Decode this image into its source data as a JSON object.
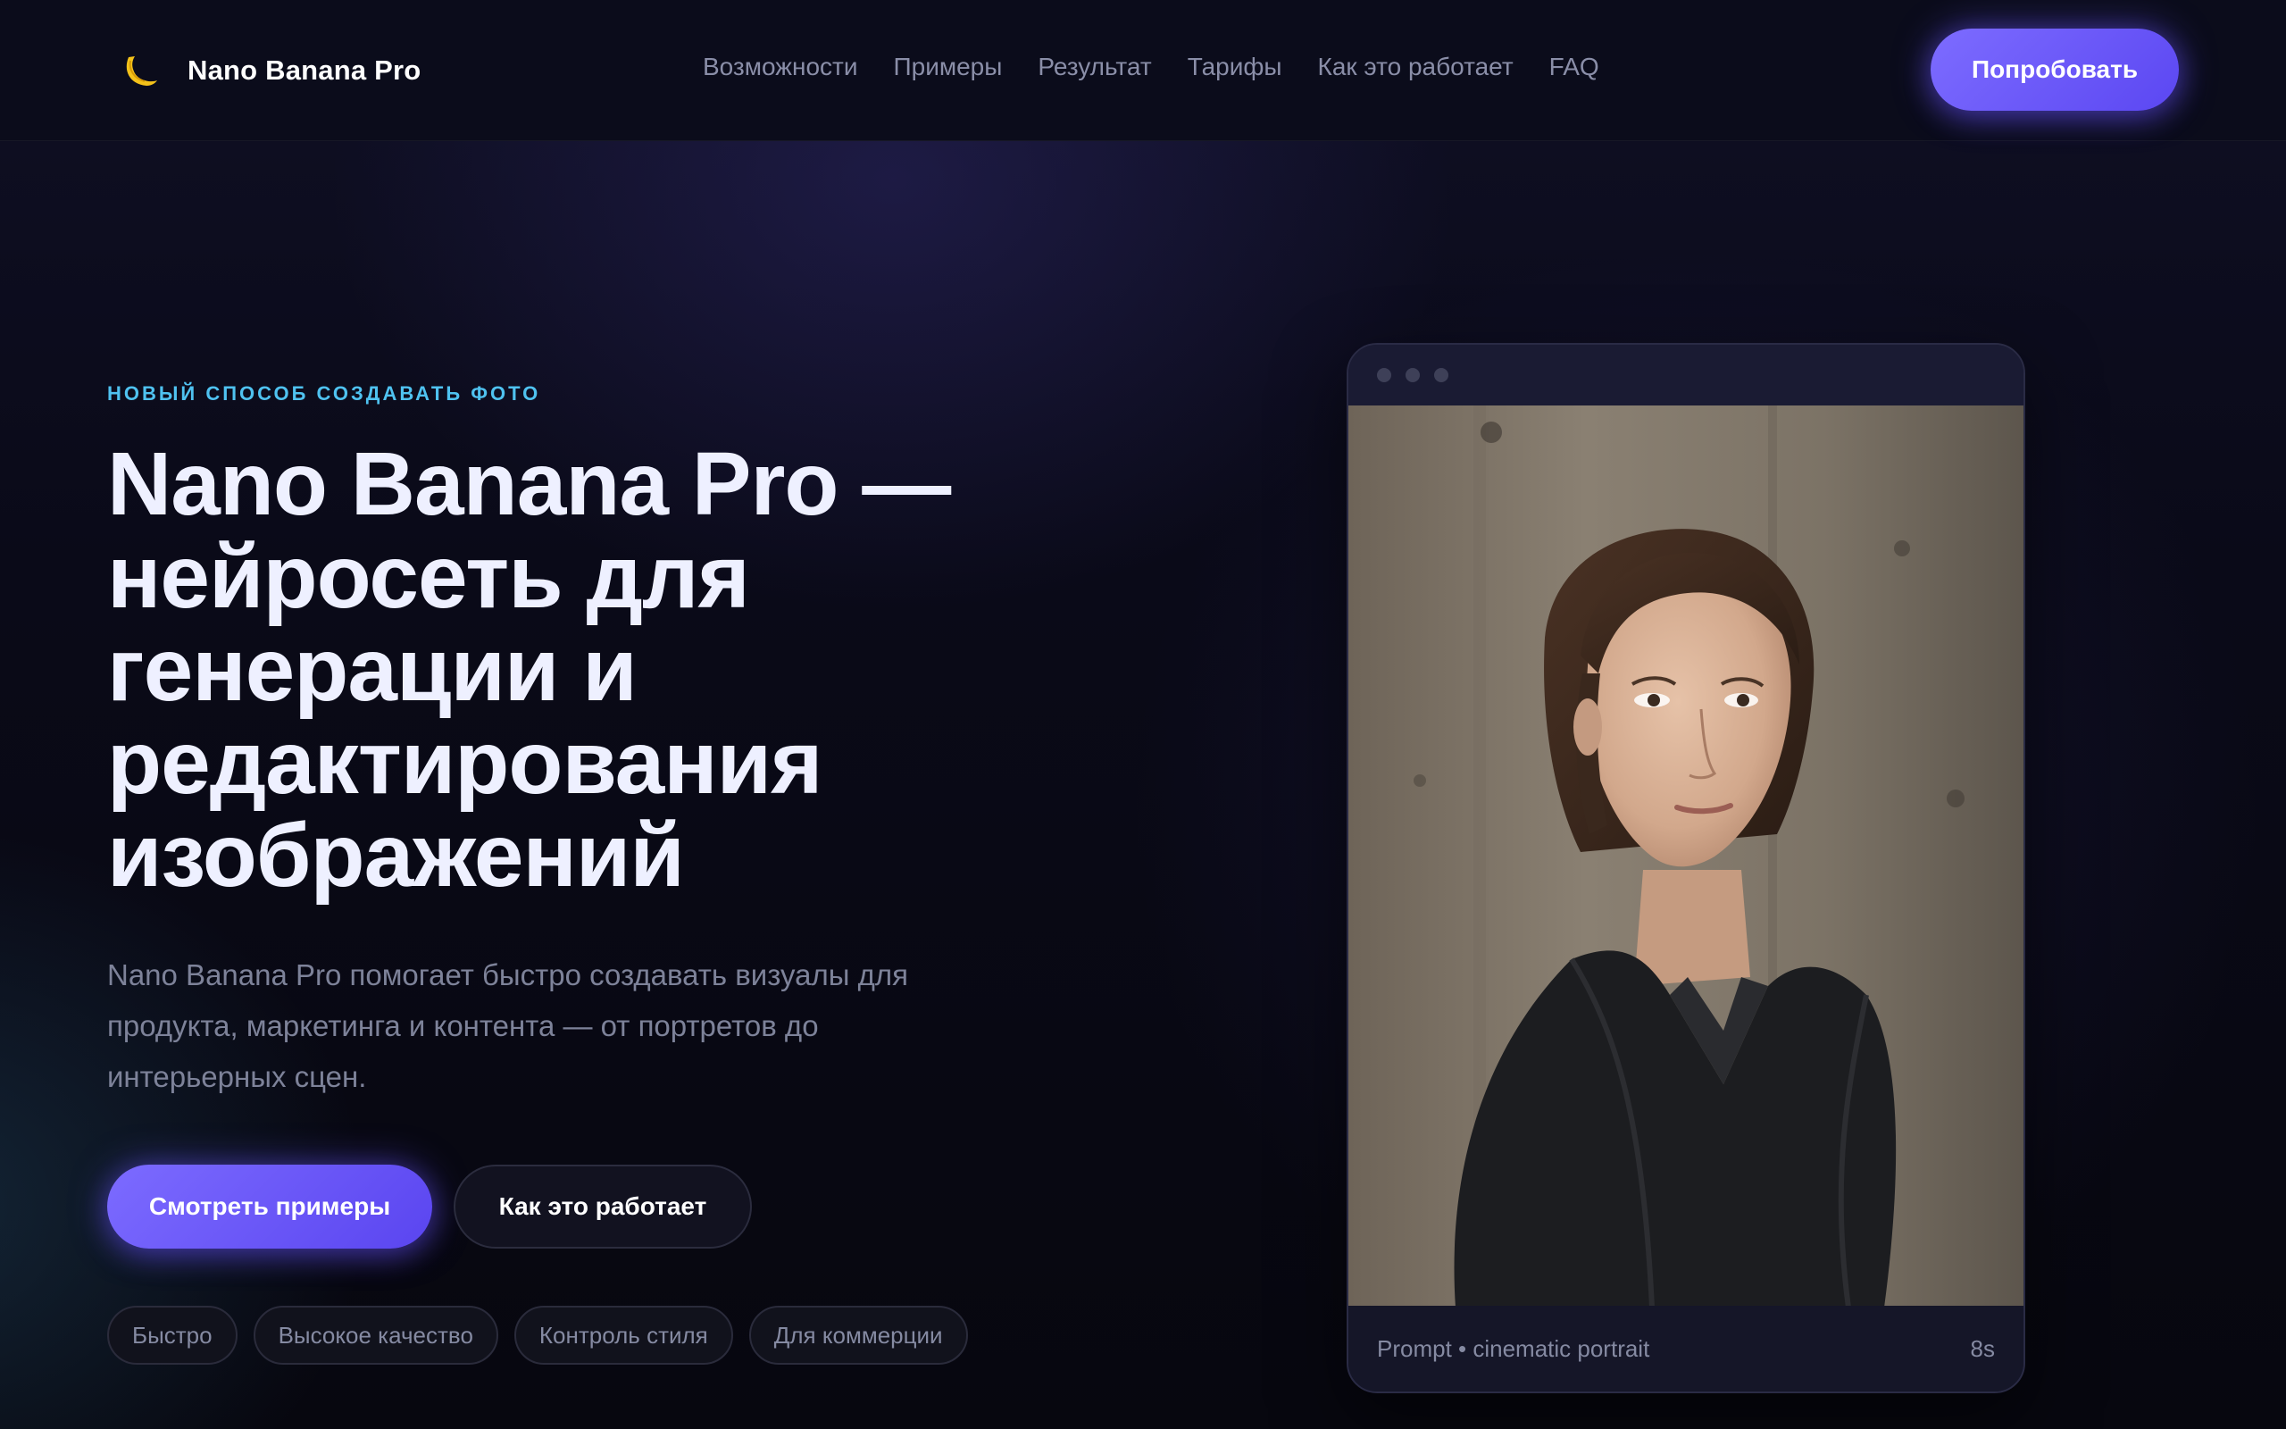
{
  "header": {
    "brand_name": "Nano Banana Pro",
    "brand_icon": "banana-moon-icon",
    "nav": [
      {
        "label": "Возможности"
      },
      {
        "label": "Примеры"
      },
      {
        "label": "Результат"
      },
      {
        "label": "Тарифы"
      },
      {
        "label": "Как это работает"
      },
      {
        "label": "FAQ"
      }
    ],
    "cta_label": "Попробовать"
  },
  "hero": {
    "eyebrow": "НОВЫЙ СПОСОБ СОЗДАВАТЬ ФОТО",
    "title_lines": [
      "Nano Banana Pro —",
      "нейросеть для",
      "генерации и",
      "редактирования",
      "изображений"
    ],
    "subtitle": "Nano Banana Pro помогает быстро создавать визуалы для продукта, маркетинга и контента — от портретов до интерьерных сцен.",
    "primary_button": "Смотреть примеры",
    "secondary_button": "Как это работает",
    "chips": [
      "Быстро",
      "Высокое качество",
      "Контроль стиля",
      "Для коммерции"
    ]
  },
  "preview": {
    "prompt": "Prompt • cinematic portrait",
    "duration": "8s"
  },
  "colors": {
    "accent": "#6c5cff",
    "eyebrow": "#4fc2f0",
    "background": "#07070e"
  }
}
